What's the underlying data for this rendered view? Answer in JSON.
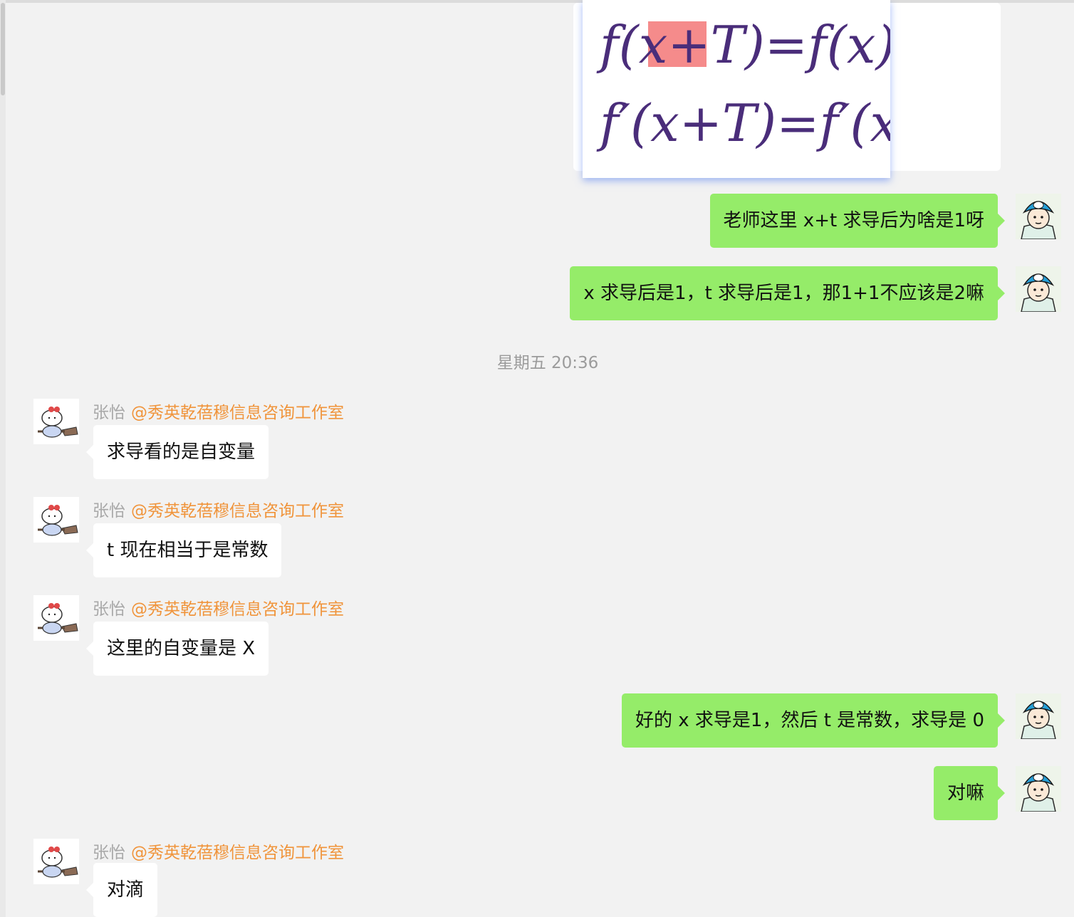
{
  "image_message": {
    "formula_line1": "f(x+T)=f(x)",
    "formula_line2": "f′(x+T)=f′(x)",
    "highlight_color": "#f58b8b",
    "ink_color": "#4a2d7a"
  },
  "colors": {
    "my_bubble": "#95ec69",
    "other_bubble": "#ffffff",
    "chat_background": "#f2f2f2",
    "sender_name": "#a8a8a8",
    "sender_group": "#f0943b"
  },
  "timestamp": "星期五 20:36",
  "messages": [
    {
      "from": "me",
      "text": "老师这里 x+t 求导后为啥是1呀"
    },
    {
      "from": "me",
      "text": "x 求导后是1，t 求导后是1，那1+1不应该是2嘛"
    },
    {
      "from": "other",
      "sender": "张怡",
      "group": "@秀英乾蓓穆信息咨询工作室",
      "text": "求导看的是自变量"
    },
    {
      "from": "other",
      "sender": "张怡",
      "group": "@秀英乾蓓穆信息咨询工作室",
      "text": "t 现在相当于是常数"
    },
    {
      "from": "other",
      "sender": "张怡",
      "group": "@秀英乾蓓穆信息咨询工作室",
      "text": "这里的自变量是 X"
    },
    {
      "from": "me",
      "text": "好的 x 求导是1，然后 t 是常数，求导是 0"
    },
    {
      "from": "me",
      "text": "对嘛"
    },
    {
      "from": "other",
      "sender": "张怡",
      "group": "@秀英乾蓓穆信息咨询工作室",
      "text": "对滴"
    }
  ],
  "avatars": {
    "me": "doraemon-cap-boy-avatar",
    "other": "hello-kitty-witch-broom-avatar"
  }
}
